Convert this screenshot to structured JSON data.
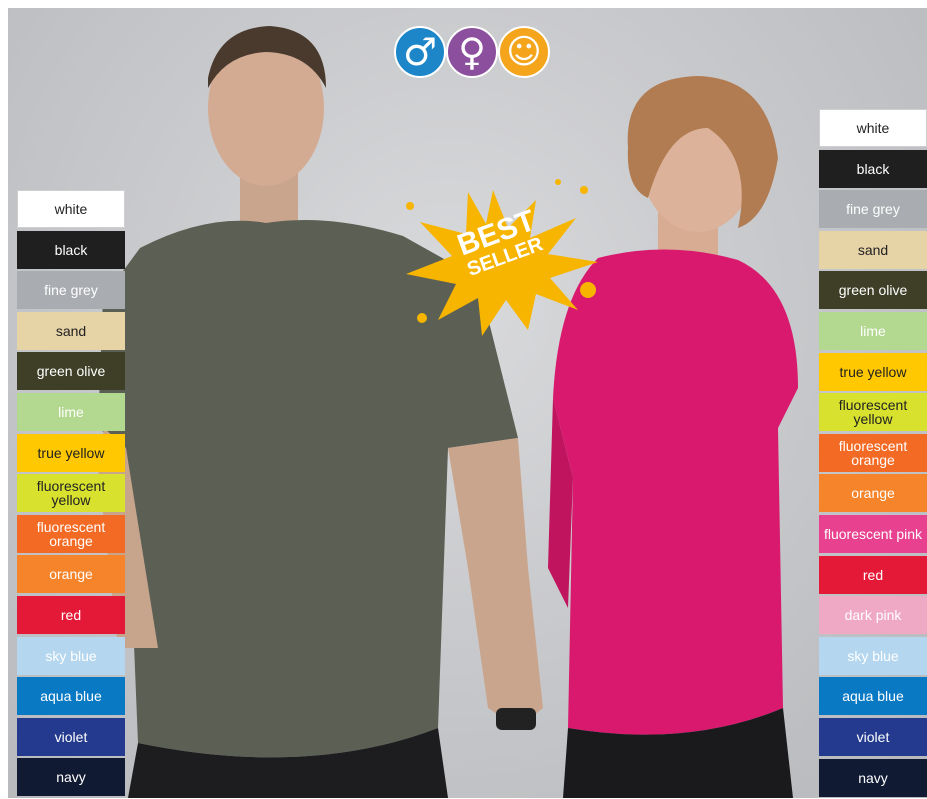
{
  "badge": {
    "line1": "BEST",
    "line2": "SELLER",
    "color": "#f7b500"
  },
  "gender_icons": [
    {
      "name": "male",
      "symbol": "♂",
      "color": "#1c86c8"
    },
    {
      "name": "female",
      "symbol": "♀",
      "color": "#8b4f9e"
    },
    {
      "name": "kids",
      "symbol": "☺",
      "color": "#f4a51c"
    }
  ],
  "left_swatches": [
    {
      "label": "white",
      "bg": "#ffffff",
      "fg": "#222222"
    },
    {
      "label": "black",
      "bg": "#1f1f1f",
      "fg": "#ffffff"
    },
    {
      "label": "fine grey",
      "bg": "#a9acb0",
      "fg": "#ffffff"
    },
    {
      "label": "sand",
      "bg": "#e6d3a6",
      "fg": "#222222"
    },
    {
      "label": "green olive",
      "bg": "#3e3f26",
      "fg": "#ffffff"
    },
    {
      "label": "lime",
      "bg": "#b3d88f",
      "fg": "#ffffff"
    },
    {
      "label": "true yellow",
      "bg": "#ffc800",
      "fg": "#222222"
    },
    {
      "label": "fluorescent yellow",
      "bg": "#d7e12e",
      "fg": "#222222"
    },
    {
      "label": "fluorescent orange",
      "bg": "#f36a24",
      "fg": "#ffffff"
    },
    {
      "label": "orange",
      "bg": "#f5842a",
      "fg": "#ffffff"
    },
    {
      "label": "red",
      "bg": "#e41937",
      "fg": "#ffffff"
    },
    {
      "label": "sky blue",
      "bg": "#b4d7ef",
      "fg": "#ffffff"
    },
    {
      "label": "aqua blue",
      "bg": "#0a79c4",
      "fg": "#ffffff"
    },
    {
      "label": "violet",
      "bg": "#233a8e",
      "fg": "#ffffff"
    },
    {
      "label": "navy",
      "bg": "#111a33",
      "fg": "#ffffff"
    }
  ],
  "right_swatches": [
    {
      "label": "white",
      "bg": "#ffffff",
      "fg": "#222222"
    },
    {
      "label": "black",
      "bg": "#1f1f1f",
      "fg": "#ffffff"
    },
    {
      "label": "fine grey",
      "bg": "#a9acb0",
      "fg": "#ffffff"
    },
    {
      "label": "sand",
      "bg": "#e6d3a6",
      "fg": "#222222"
    },
    {
      "label": "green olive",
      "bg": "#3e3f26",
      "fg": "#ffffff"
    },
    {
      "label": "lime",
      "bg": "#b3d88f",
      "fg": "#ffffff"
    },
    {
      "label": "true yellow",
      "bg": "#ffc800",
      "fg": "#222222"
    },
    {
      "label": "fluorescent yellow",
      "bg": "#d7e12e",
      "fg": "#222222"
    },
    {
      "label": "fluorescent orange",
      "bg": "#f36a24",
      "fg": "#ffffff"
    },
    {
      "label": "orange",
      "bg": "#f5842a",
      "fg": "#ffffff"
    },
    {
      "label": "fluorescent pink",
      "bg": "#e8418f",
      "fg": "#ffffff"
    },
    {
      "label": "red",
      "bg": "#e41937",
      "fg": "#ffffff"
    },
    {
      "label": "dark pink",
      "bg": "#f0a9c4",
      "fg": "#ffffff"
    },
    {
      "label": "sky blue",
      "bg": "#b4d7ef",
      "fg": "#ffffff"
    },
    {
      "label": "aqua blue",
      "bg": "#0a79c4",
      "fg": "#ffffff"
    },
    {
      "label": "violet",
      "bg": "#233a8e",
      "fg": "#ffffff"
    },
    {
      "label": "navy",
      "bg": "#111a33",
      "fg": "#ffffff"
    }
  ]
}
